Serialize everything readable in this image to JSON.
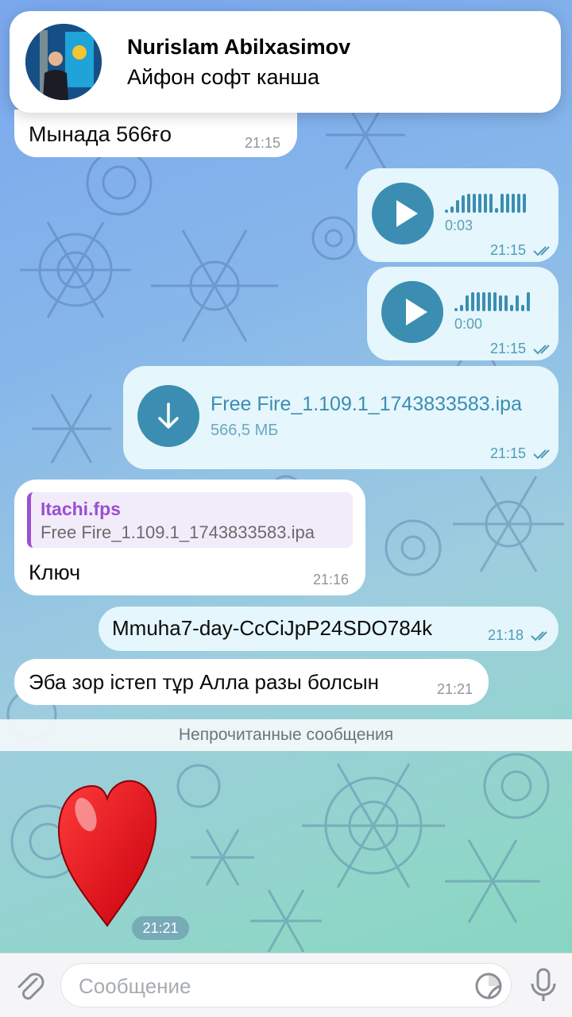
{
  "notification": {
    "sender": "Nurislam Abilxasimov",
    "message": "Айфон софт канша"
  },
  "messages": {
    "m1": {
      "text": "Мынада 566ғо",
      "time": "21:15"
    },
    "voice1": {
      "duration": "0:03",
      "time": "21:15"
    },
    "voice2": {
      "duration": "0:00",
      "time": "21:15"
    },
    "file": {
      "name": "Free Fire_1.109.1_1743833583.ipa",
      "size": "566,5 МБ",
      "time": "21:15"
    },
    "reply": {
      "author": "Itachi.fps",
      "quoted": "Free Fire_1.109.1_1743833583.ipa",
      "text": "Ключ",
      "time": "21:16"
    },
    "key": {
      "text": "Mmuha7-day-CcCiJpP24SDO784k",
      "time": "21:18"
    },
    "thanks": {
      "text": "Эба зор істеп тұр Алла разы болсын",
      "time": "21:21"
    },
    "heart": {
      "emoji": "❤️",
      "time": "21:21"
    }
  },
  "unread_label": "Непрочитанные сообщения",
  "composer": {
    "placeholder": "Сообщение",
    "attach_icon": "paperclip-icon",
    "sticker_icon": "sticker-icon",
    "mic_icon": "microphone-icon"
  },
  "colors": {
    "accent": "#3b8eb1",
    "outgoing_bubble": "#e5f6fc",
    "incoming_bubble": "#ffffff",
    "reply_author": "#9a4fd0",
    "heart": "#e8101c"
  }
}
